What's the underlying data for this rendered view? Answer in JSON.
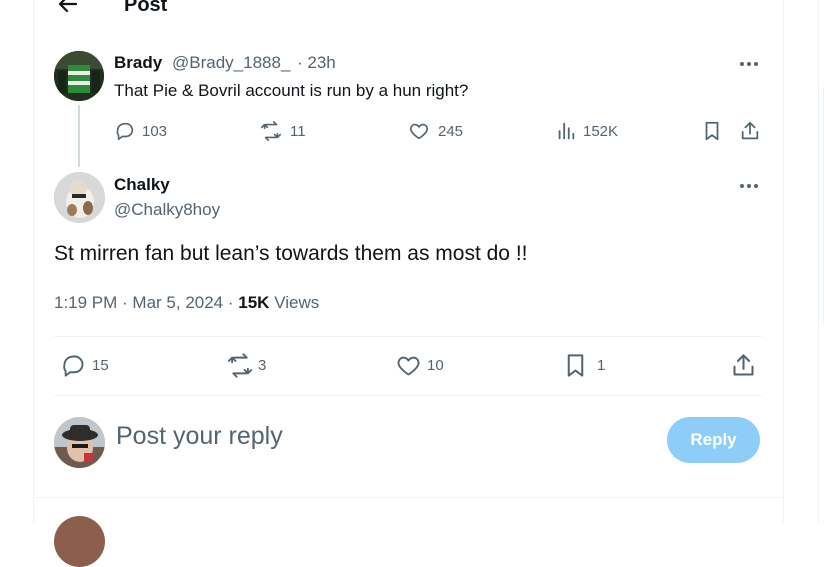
{
  "header": {
    "title": "Post"
  },
  "parent_post": {
    "name": "Brady",
    "handle": "@Brady_1888_",
    "time": "· 23h",
    "text": "That Pie & Bovril account is run by a hun right?",
    "replies": "103",
    "reposts": "11",
    "likes": "245",
    "views": "152K"
  },
  "main_post": {
    "name": "Chalky",
    "handle": "@Chalky8hoy",
    "text": "St mirren fan but lean’s towards them as most do !!",
    "timestamp": "1:19 PM · Mar 5, 2024 ·",
    "views_count": "15K",
    "views_label": "Views",
    "replies": "15",
    "reposts": "3",
    "likes": "10",
    "bookmarks": "1"
  },
  "reply_box": {
    "placeholder": "Post your reply",
    "button": "Reply"
  },
  "colors": {
    "accent": "#1d9bf0",
    "reply_button_disabled": "#8ecdf8",
    "muted_text": "#536471",
    "border": "#eff3f4"
  },
  "icons": [
    "back-arrow-icon",
    "more-icon",
    "reply-icon",
    "repost-icon",
    "like-icon",
    "views-icon",
    "bookmark-icon",
    "share-icon"
  ]
}
